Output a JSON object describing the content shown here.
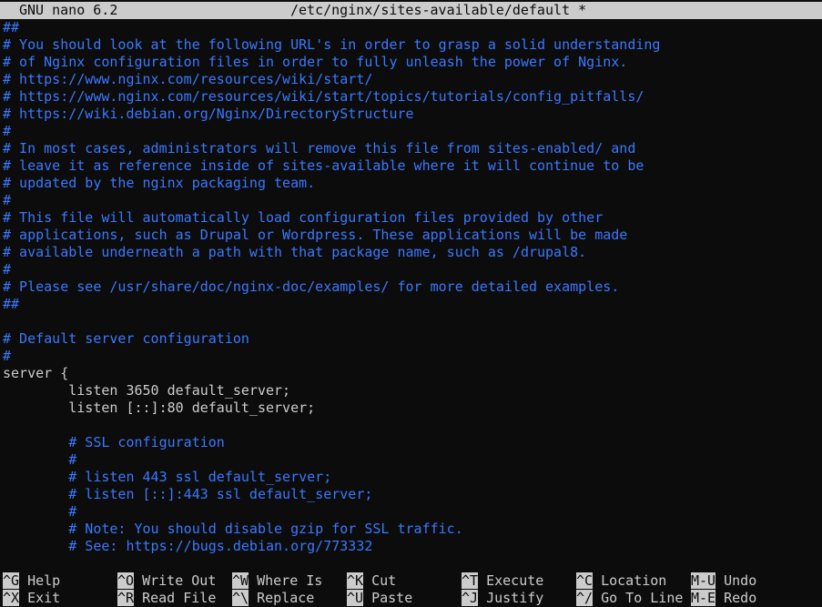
{
  "titlebar": {
    "app": "GNU nano 6.2",
    "file": "/etc/nginx/sites-available/default *"
  },
  "lines": [
    {
      "text": "##",
      "type": "comment"
    },
    {
      "text": "# You should look at the following URL's in order to grasp a solid understanding",
      "type": "comment"
    },
    {
      "text": "# of Nginx configuration files in order to fully unleash the power of Nginx.",
      "type": "comment"
    },
    {
      "text": "# https://www.nginx.com/resources/wiki/start/",
      "type": "comment"
    },
    {
      "text": "# https://www.nginx.com/resources/wiki/start/topics/tutorials/config_pitfalls/",
      "type": "comment"
    },
    {
      "text": "# https://wiki.debian.org/Nginx/DirectoryStructure",
      "type": "comment"
    },
    {
      "text": "#",
      "type": "comment"
    },
    {
      "text": "# In most cases, administrators will remove this file from sites-enabled/ and",
      "type": "comment"
    },
    {
      "text": "# leave it as reference inside of sites-available where it will continue to be",
      "type": "comment"
    },
    {
      "text": "# updated by the nginx packaging team.",
      "type": "comment"
    },
    {
      "text": "#",
      "type": "comment"
    },
    {
      "text": "# This file will automatically load configuration files provided by other",
      "type": "comment"
    },
    {
      "text": "# applications, such as Drupal or Wordpress. These applications will be made",
      "type": "comment"
    },
    {
      "text": "# available underneath a path with that package name, such as /drupal8.",
      "type": "comment"
    },
    {
      "text": "#",
      "type": "comment"
    },
    {
      "text": "# Please see /usr/share/doc/nginx-doc/examples/ for more detailed examples.",
      "type": "comment"
    },
    {
      "text": "##",
      "type": "comment"
    },
    {
      "text": "",
      "type": "code"
    },
    {
      "text": "# Default server configuration",
      "type": "comment"
    },
    {
      "text": "#",
      "type": "comment"
    },
    {
      "text": "server {",
      "type": "code"
    },
    {
      "text": "        listen 3650 default_server;",
      "type": "code"
    },
    {
      "text": "        listen [::]:80 default_server;",
      "type": "code"
    },
    {
      "text": "",
      "type": "code"
    },
    {
      "text": "        # SSL configuration",
      "type": "comment"
    },
    {
      "text": "        #",
      "type": "comment"
    },
    {
      "text": "        # listen 443 ssl default_server;",
      "type": "comment"
    },
    {
      "text": "        # listen [::]:443 ssl default_server;",
      "type": "comment"
    },
    {
      "text": "        #",
      "type": "comment"
    },
    {
      "text": "        # Note: You should disable gzip for SSL traffic.",
      "type": "comment"
    },
    {
      "text": "        # See: https://bugs.debian.org/773332",
      "type": "comment"
    }
  ],
  "shortcuts": [
    {
      "key": "^G",
      "label": "Help"
    },
    {
      "key": "^X",
      "label": "Exit"
    },
    {
      "key": "^O",
      "label": "Write Out"
    },
    {
      "key": "^R",
      "label": "Read File"
    },
    {
      "key": "^W",
      "label": "Where Is"
    },
    {
      "key": "^\\",
      "label": "Replace"
    },
    {
      "key": "^K",
      "label": "Cut"
    },
    {
      "key": "^U",
      "label": "Paste"
    },
    {
      "key": "^T",
      "label": "Execute"
    },
    {
      "key": "^J",
      "label": "Justify"
    },
    {
      "key": "^C",
      "label": "Location"
    },
    {
      "key": "^/",
      "label": "Go To Line"
    },
    {
      "key": "M-U",
      "label": "Undo"
    },
    {
      "key": "M-E",
      "label": "Redo"
    }
  ],
  "colors": {
    "background": "#0c0c0c",
    "text": "#cccccc",
    "comment": "#3b78ff",
    "titlebar_bg": "#cccccc"
  }
}
